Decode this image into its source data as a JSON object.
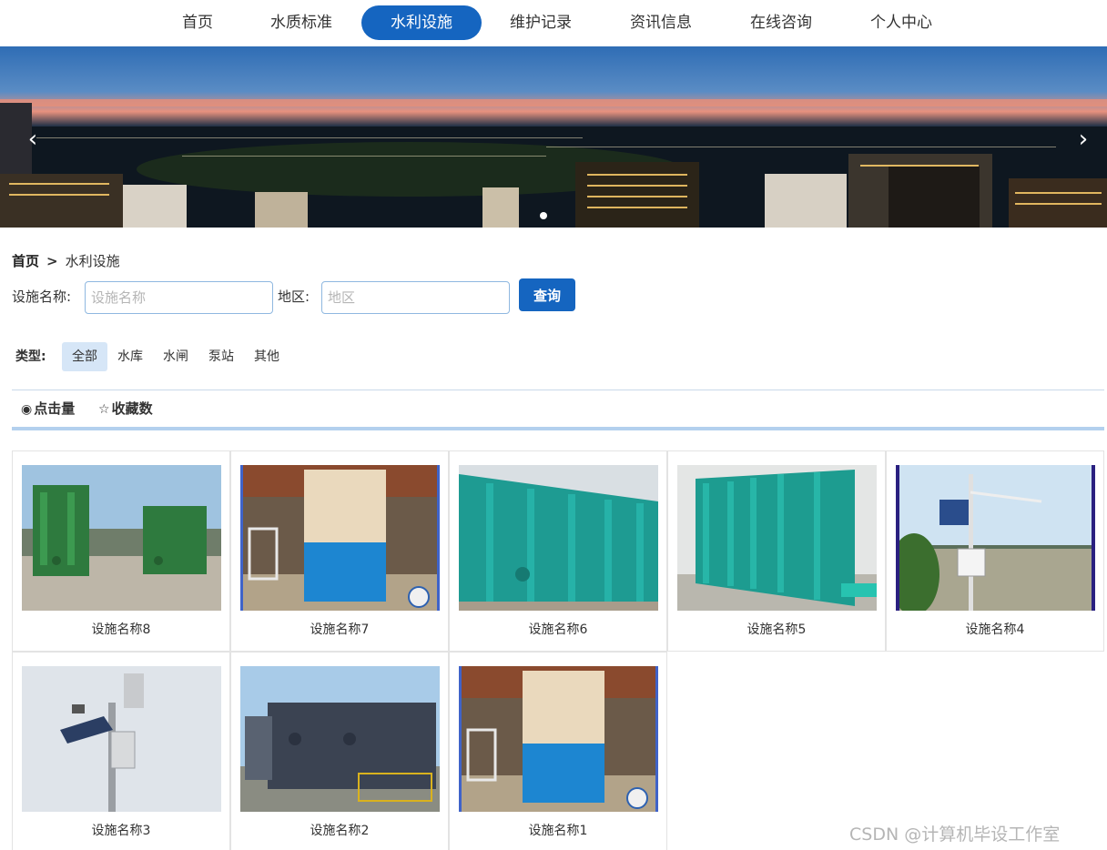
{
  "nav": {
    "items": [
      "首页",
      "水质标准",
      "水利设施",
      "维护记录",
      "资讯信息",
      "在线咨询",
      "个人中心"
    ],
    "active_index": 2
  },
  "banner": {
    "slide_count": 1,
    "active_slide": 0
  },
  "breadcrumb": {
    "home": "首页",
    "separator": ">",
    "current": "水利设施"
  },
  "search": {
    "name_label": "设施名称:",
    "name_placeholder": "设施名称",
    "name_value": "",
    "region_label": "地区:",
    "region_placeholder": "地区",
    "region_value": "",
    "query_button": "查询"
  },
  "type_filter": {
    "label": "类型:",
    "options": [
      "全部",
      "水库",
      "水闸",
      "泵站",
      "其他"
    ],
    "selected": "全部"
  },
  "sort": {
    "clicks": {
      "icon": "eye-icon",
      "label": "点击量"
    },
    "favorites": {
      "icon": "star-icon",
      "label": "收藏数"
    }
  },
  "facilities": [
    {
      "name": "设施名称8",
      "image": "green-water-tank-outdoor"
    },
    {
      "name": "设施名称7",
      "image": "beige-blue-tank-workshop"
    },
    {
      "name": "设施名称6",
      "image": "teal-tank-long"
    },
    {
      "name": "设施名称5",
      "image": "teal-tank-outdoor"
    },
    {
      "name": "设施名称4",
      "image": "solar-monitoring-station-river"
    },
    {
      "name": "设施名称3",
      "image": "solar-camera-pole"
    },
    {
      "name": "设施名称2",
      "image": "dark-gray-tank-outdoor"
    },
    {
      "name": "设施名称1",
      "image": "beige-blue-tank-workshop"
    }
  ],
  "watermark": "CSDN @计算机毕设工作室",
  "colors": {
    "primary": "#1565c0",
    "tag_selected": "#d6e6f7",
    "divider": "#b3d0ee"
  }
}
